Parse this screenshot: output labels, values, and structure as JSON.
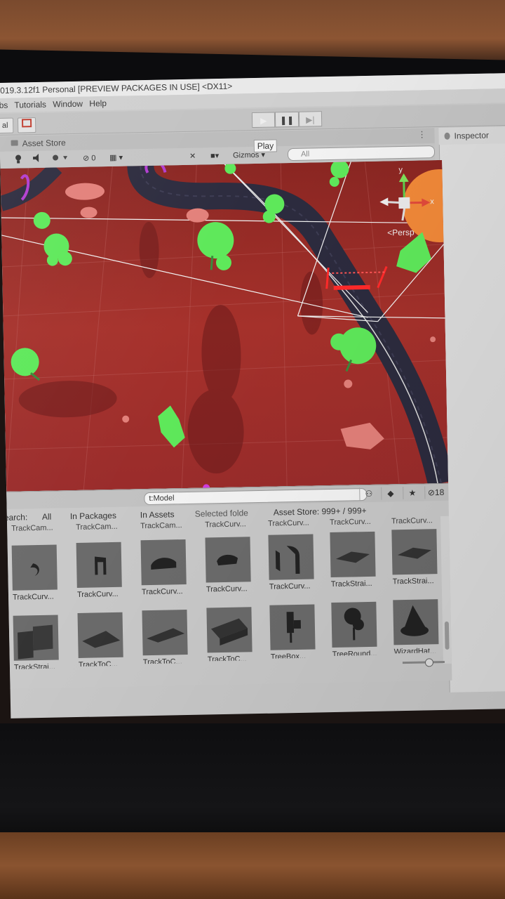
{
  "window": {
    "title": "019.3.12f1 Personal [PREVIEW PACKAGES IN USE] <DX11>"
  },
  "menu": [
    "bs",
    "Tutorials",
    "Window",
    "Help"
  ],
  "toolbar": {
    "left_button": "al",
    "play_tooltip": "Play",
    "play_icon": "▶",
    "pause_icon": "❚❚",
    "step_icon": "▶|"
  },
  "tabs": {
    "asset_store": "Asset Store",
    "inspector": "Inspector"
  },
  "scene_toolbar": {
    "gizmos": "Gizmos",
    "hidden_count": "0",
    "search_placeholder": "All"
  },
  "scene": {
    "persp_label": "<Persp",
    "axis_y": "y",
    "axis_x": "x"
  },
  "project": {
    "search_value": "t:Model",
    "hidden_count": "18",
    "filter": {
      "label": "earch:",
      "all": "All",
      "in_packages": "In Packages",
      "in_assets": "In Assets",
      "selected_folder": "Selected folde",
      "asset_store": "Asset Store: 999+ / 999+"
    },
    "top_names": [
      "TrackCam...",
      "TrackCam...",
      "TrackCam...",
      "TrackCurv...",
      "TrackCurv...",
      "TrackCurv...",
      "TrackCurv..."
    ],
    "row1": [
      "TrackCurv...",
      "TrackCurv...",
      "TrackCurv...",
      "TrackCurv...",
      "TrackCurv...",
      "TrackStrai...",
      "TrackStrai..."
    ],
    "row2": [
      "TrackStrai...",
      "TrackToC...",
      "TrackToC...",
      "TrackToC...",
      "TreeBox...",
      "TreeRound...",
      "WizardHat..."
    ]
  }
}
